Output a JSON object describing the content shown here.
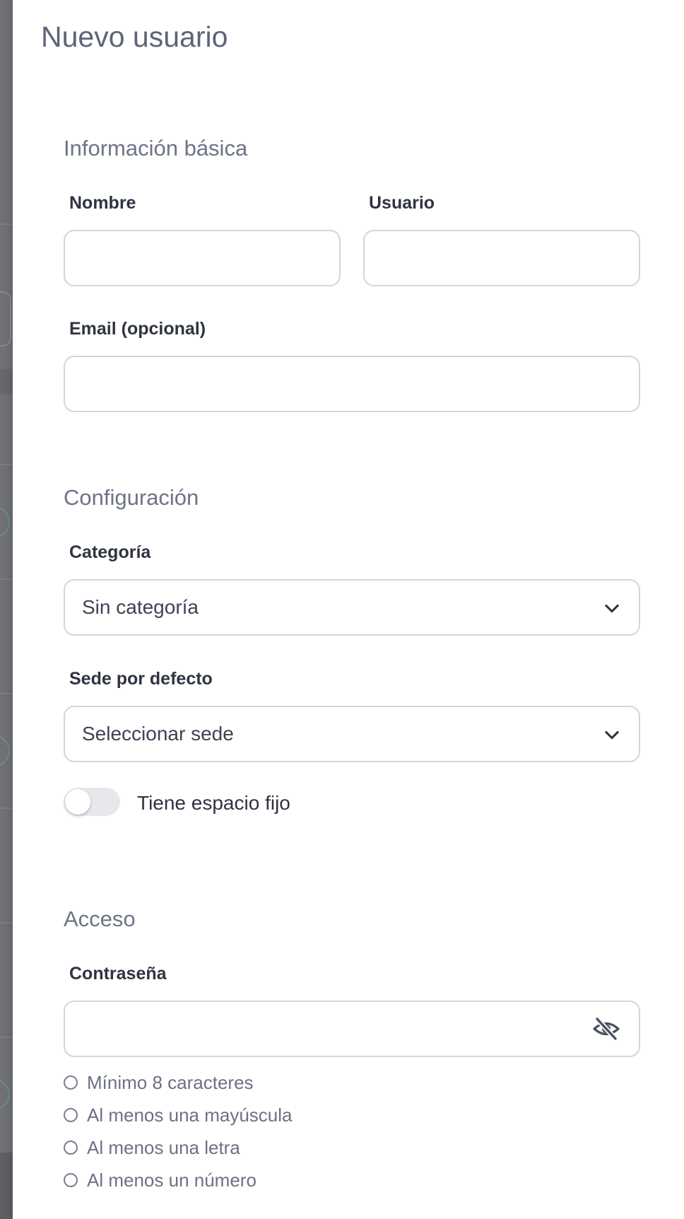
{
  "dialog": {
    "title": "Nuevo usuario"
  },
  "basic_info": {
    "heading": "Información básica",
    "name_label": "Nombre",
    "name_value": "",
    "username_label": "Usuario",
    "username_value": "",
    "email_label": "Email (opcional)",
    "email_value": ""
  },
  "configuration": {
    "heading": "Configuración",
    "category_label": "Categoría",
    "category_selected": "Sin categoría",
    "site_label": "Sede por defecto",
    "site_selected": "Seleccionar sede",
    "fixed_space_label": "Tiene espacio fijo",
    "fixed_space_enabled": false
  },
  "access": {
    "heading": "Acceso",
    "password_label": "Contraseña",
    "password_value": "",
    "password_visibility_icon": "eye-off-icon",
    "requirements": [
      "Mínimo 8 caracteres",
      "Al menos una mayúscula",
      "Al menos una letra",
      "Al menos un número"
    ]
  },
  "colors": {
    "title": "#5e6478",
    "section_heading": "#6e7386",
    "label": "#2f3441",
    "input_border": "#d3d5db",
    "toggle_off": "#e7e8ec",
    "backdrop": "#6f7175"
  }
}
